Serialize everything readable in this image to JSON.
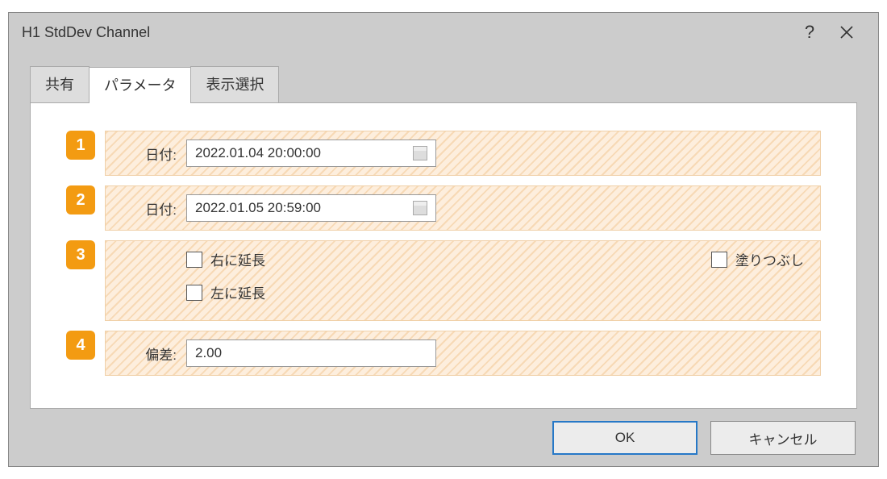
{
  "titlebar": {
    "title": "H1 StdDev Channel"
  },
  "tabs": {
    "shared": "共有",
    "params": "パラメータ",
    "display": "表示選択"
  },
  "rows": {
    "r1": {
      "badge": "1",
      "label": "日付:",
      "value": "2022.01.04 20:00:00"
    },
    "r2": {
      "badge": "2",
      "label": "日付:",
      "value": "2022.01.05 20:59:00"
    },
    "r3": {
      "badge": "3",
      "extend_right": "右に延長",
      "extend_left": "左に延長",
      "fill": "塗りつぶし"
    },
    "r4": {
      "badge": "4",
      "label": "偏差:",
      "value": "2.00"
    }
  },
  "buttons": {
    "ok": "OK",
    "cancel": "キャンセル"
  }
}
